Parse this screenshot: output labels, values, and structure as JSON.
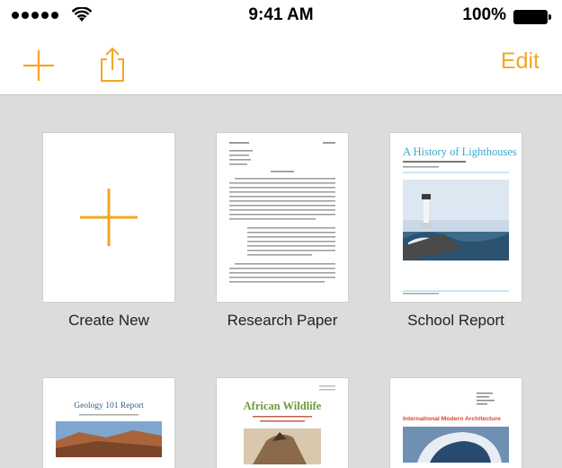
{
  "status": {
    "time": "9:41 AM",
    "battery": "100%"
  },
  "nav": {
    "edit_label": "Edit"
  },
  "templates": [
    {
      "label": "Create New"
    },
    {
      "label": "Research Paper"
    },
    {
      "label": "School Report",
      "doc_title": "A History of Lighthouses"
    },
    {
      "label": "",
      "doc_title": "Geology 101 Report"
    },
    {
      "label": "",
      "doc_title": "African Wildlife"
    },
    {
      "label": "",
      "doc_title": "International Modern Architecture"
    }
  ],
  "colors": {
    "accent": "#f5a623",
    "background": "#dcdcdc"
  }
}
